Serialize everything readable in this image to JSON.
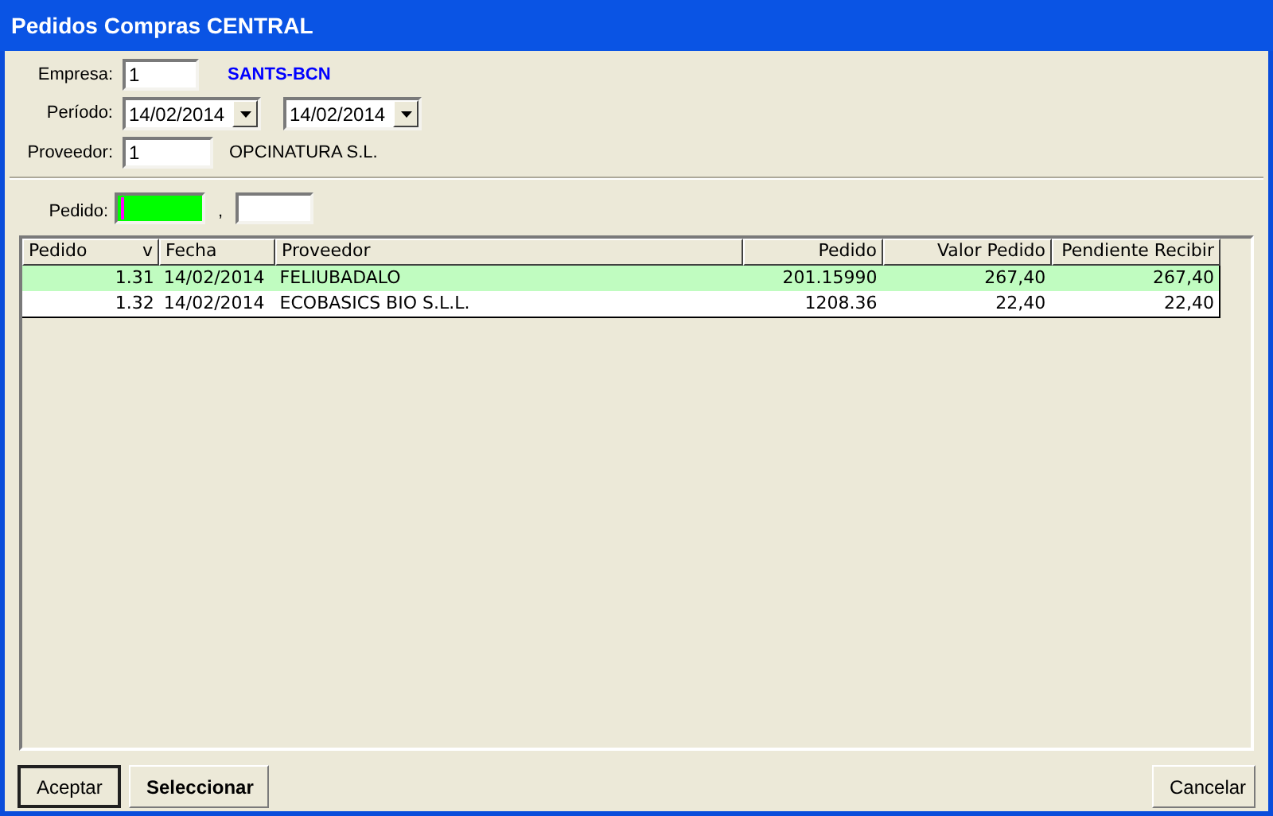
{
  "window": {
    "title": "Pedidos Compras CENTRAL"
  },
  "form": {
    "empresa": {
      "label": "Empresa:",
      "value": "1",
      "name": "SANTS-BCN"
    },
    "periodo": {
      "label": "Período:",
      "from": "14/02/2014",
      "to": "14/02/2014"
    },
    "proveedor": {
      "label": "Proveedor:",
      "value": "1",
      "name": "OPCINATURA S.L."
    },
    "pedido": {
      "label": "Pedido:",
      "separator": ","
    }
  },
  "table": {
    "columns": [
      {
        "label": "Pedido",
        "sort_mark": "v"
      },
      {
        "label": "Fecha"
      },
      {
        "label": "Proveedor"
      },
      {
        "label": "Pedido"
      },
      {
        "label": "Valor Pedido"
      },
      {
        "label": "Pendiente Recibir"
      }
    ],
    "rows": [
      {
        "selected": true,
        "cells": [
          "1.31",
          "14/02/2014",
          "FELIUBADALO",
          "201.15990",
          "267,40",
          "267,40"
        ]
      },
      {
        "selected": false,
        "cells": [
          "1.32",
          "14/02/2014",
          "ECOBASICS BIO S.L.L.",
          "1208.36",
          "22,40",
          "22,40"
        ]
      }
    ]
  },
  "buttons": [
    {
      "label": "Aceptar",
      "kind": "default"
    },
    {
      "label": "Seleccionar",
      "kind": "bold"
    },
    {
      "label": "Cancelar",
      "kind": "normal"
    }
  ]
}
